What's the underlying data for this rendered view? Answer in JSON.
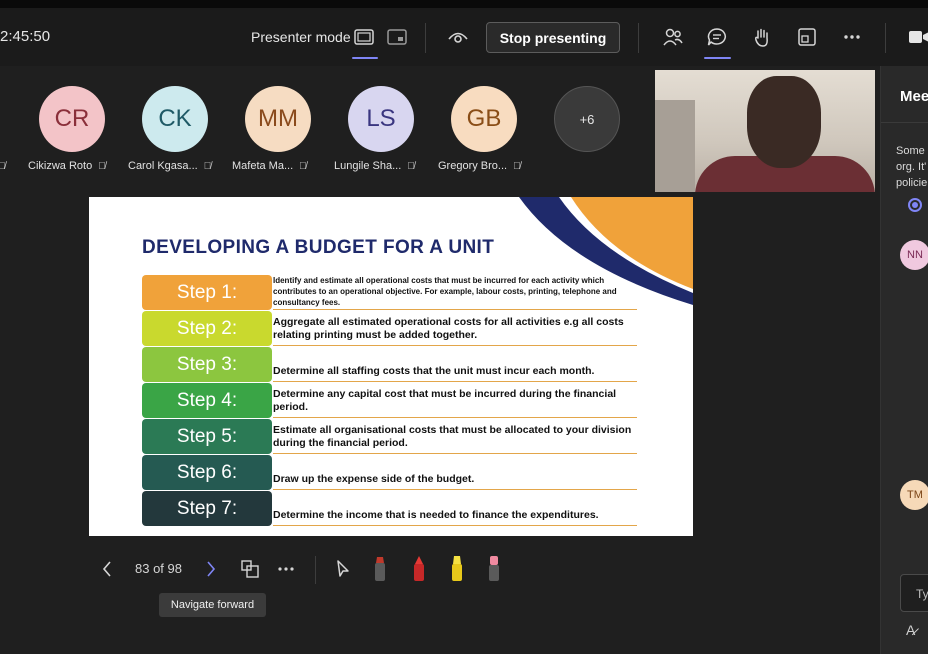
{
  "topbar": {
    "clock": "2:45:50",
    "presenter_mode_label": "Presenter mode",
    "stop_presenting_label": "Stop presenting",
    "accent_color": "#7f85f5"
  },
  "participants": [
    {
      "initials": "CR",
      "name": "Cikizwa Roto",
      "bg": "#f3c4c8",
      "fg": "#8a2f3a"
    },
    {
      "initials": "CK",
      "name": "Carol Kgasa...",
      "bg": "#cdeaee",
      "fg": "#1f5a66"
    },
    {
      "initials": "MM",
      "name": "Mafeta Ma...",
      "bg": "#f6dcc2",
      "fg": "#8a4a1c"
    },
    {
      "initials": "LS",
      "name": "Lungile Sha...",
      "bg": "#d8d6f0",
      "fg": "#3a3680"
    },
    {
      "initials": "GB",
      "name": "Gregory Bro...",
      "bg": "#f8dcc0",
      "fg": "#8a4d16"
    },
    {
      "initials": "+6",
      "name": "",
      "bg": "#3a3a3a",
      "fg": "#e6e6e6"
    }
  ],
  "panel": {
    "title": "Mee",
    "preview_lines": [
      "Some",
      "org. It'",
      "policie"
    ],
    "avatars": [
      {
        "initials": "NN",
        "bg": "#f0c9df",
        "fg": "#7a2a55"
      },
      {
        "initials": "TM",
        "bg": "#f6d9b8",
        "fg": "#7a4416"
      }
    ],
    "compose_placeholder": "Ty"
  },
  "slide": {
    "title": "DEVELOPING A BUDGET FOR A UNIT",
    "steps": [
      {
        "label": "Step 1:",
        "color": "#f0a23a",
        "desc": "Identify and estimate all operational costs that must be incurred for each activity which contributes to an operational objective. For example, labour costs, printing, telephone and consultancy fees."
      },
      {
        "label": "Step 2:",
        "color": "#c9d92e",
        "desc": "Aggregate all estimated operational costs for all activities e.g all costs relating printing must be added together."
      },
      {
        "label": "Step 3:",
        "color": "#8cc63f",
        "desc": "Determine all staffing costs that the unit must incur each month."
      },
      {
        "label": "Step 4:",
        "color": "#3aa546",
        "desc": "Determine any capital cost that must be incurred during the financial period."
      },
      {
        "label": "Step 5:",
        "color": "#2b7a55",
        "desc": "Estimate all organisational costs that must be allocated to your division during the financial period."
      },
      {
        "label": "Step 6:",
        "color": "#255a52",
        "desc": "Draw up the expense side of the budget."
      },
      {
        "label": "Step 7:",
        "color": "#23383c",
        "desc": "Determine the income that is needed to finance the expenditures."
      }
    ]
  },
  "controls": {
    "page_indicator": "83 of 98",
    "tooltip": "Navigate forward"
  }
}
